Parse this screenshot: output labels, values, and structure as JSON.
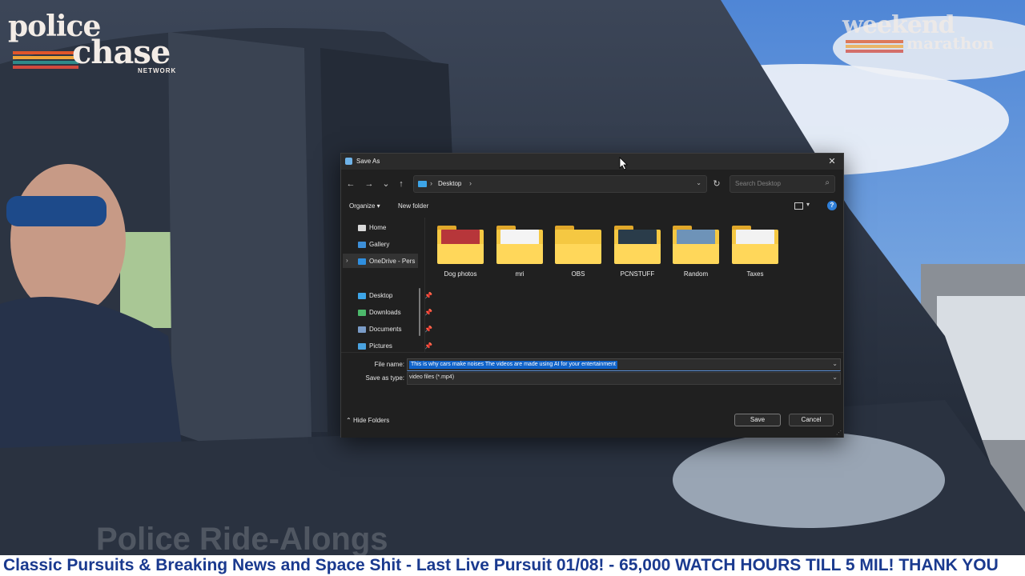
{
  "overlay": {
    "logo_left": {
      "line1": "police",
      "line2": "chase",
      "line3": "NETWORK"
    },
    "logo_right": {
      "line1": "weekend",
      "line2": "marathon"
    },
    "watermark": "Police Ride-Alongs",
    "ticker": "Classic Pursuits & Breaking News and Space Shit - Last Live Pursuit 01/08! - 65,000 WATCH HOURS TILL 5 MIL! THANK YOU"
  },
  "dialog": {
    "title": "Save As",
    "close_glyph": "✕",
    "nav": {
      "back": "←",
      "forward": "→",
      "recent": "⌄",
      "up": "↑"
    },
    "address": {
      "separator": "›",
      "crumb": "Desktop",
      "dropdown": "⌄"
    },
    "refresh_glyph": "↻",
    "search_placeholder": "Search Desktop",
    "toolbar": {
      "organize": "Organize ▾",
      "new_folder": "New folder",
      "view_dropdown": "▾",
      "help": "?"
    },
    "nav_items": [
      {
        "label": "Home",
        "color": "#d9d9d9"
      },
      {
        "label": "Gallery",
        "color": "#3d8fd8"
      },
      {
        "label": "OneDrive - Pers",
        "color": "#2f8fe0",
        "chevron": "›"
      },
      {
        "label": "Desktop",
        "color": "#3da5e8",
        "pin": "📌"
      },
      {
        "label": "Downloads",
        "color": "#4cb86b",
        "pin": "📌"
      },
      {
        "label": "Documents",
        "color": "#7a9cc8",
        "pin": "📌"
      },
      {
        "label": "Pictures",
        "color": "#4aa3e0",
        "pin": "📌"
      }
    ],
    "folders": [
      {
        "name": "Dog photos",
        "thumb": "#b7363a"
      },
      {
        "name": "mri",
        "thumb": "#f4f4f4"
      },
      {
        "name": "OBS",
        "thumb": ""
      },
      {
        "name": "PCNSTUFF",
        "thumb": "#2a3c4a"
      },
      {
        "name": "Random",
        "thumb": "#6e93b8"
      },
      {
        "name": "Taxes",
        "thumb": "#f2f2f2"
      }
    ],
    "file_name_label": "File name:",
    "file_name_value": "This is why cars make noises  The videos are made using AI for your entertainment",
    "save_type_label": "Save as type:",
    "save_type_value": "video files (*.mp4)",
    "hide_folders": "Hide Folders",
    "hide_folders_chevron": "⌃",
    "save_button": "Save",
    "cancel_button": "Cancel",
    "colors": {
      "accent": "#0f62c8",
      "folder": "#f5c842",
      "ticker_text": "#1a3a8f"
    }
  }
}
